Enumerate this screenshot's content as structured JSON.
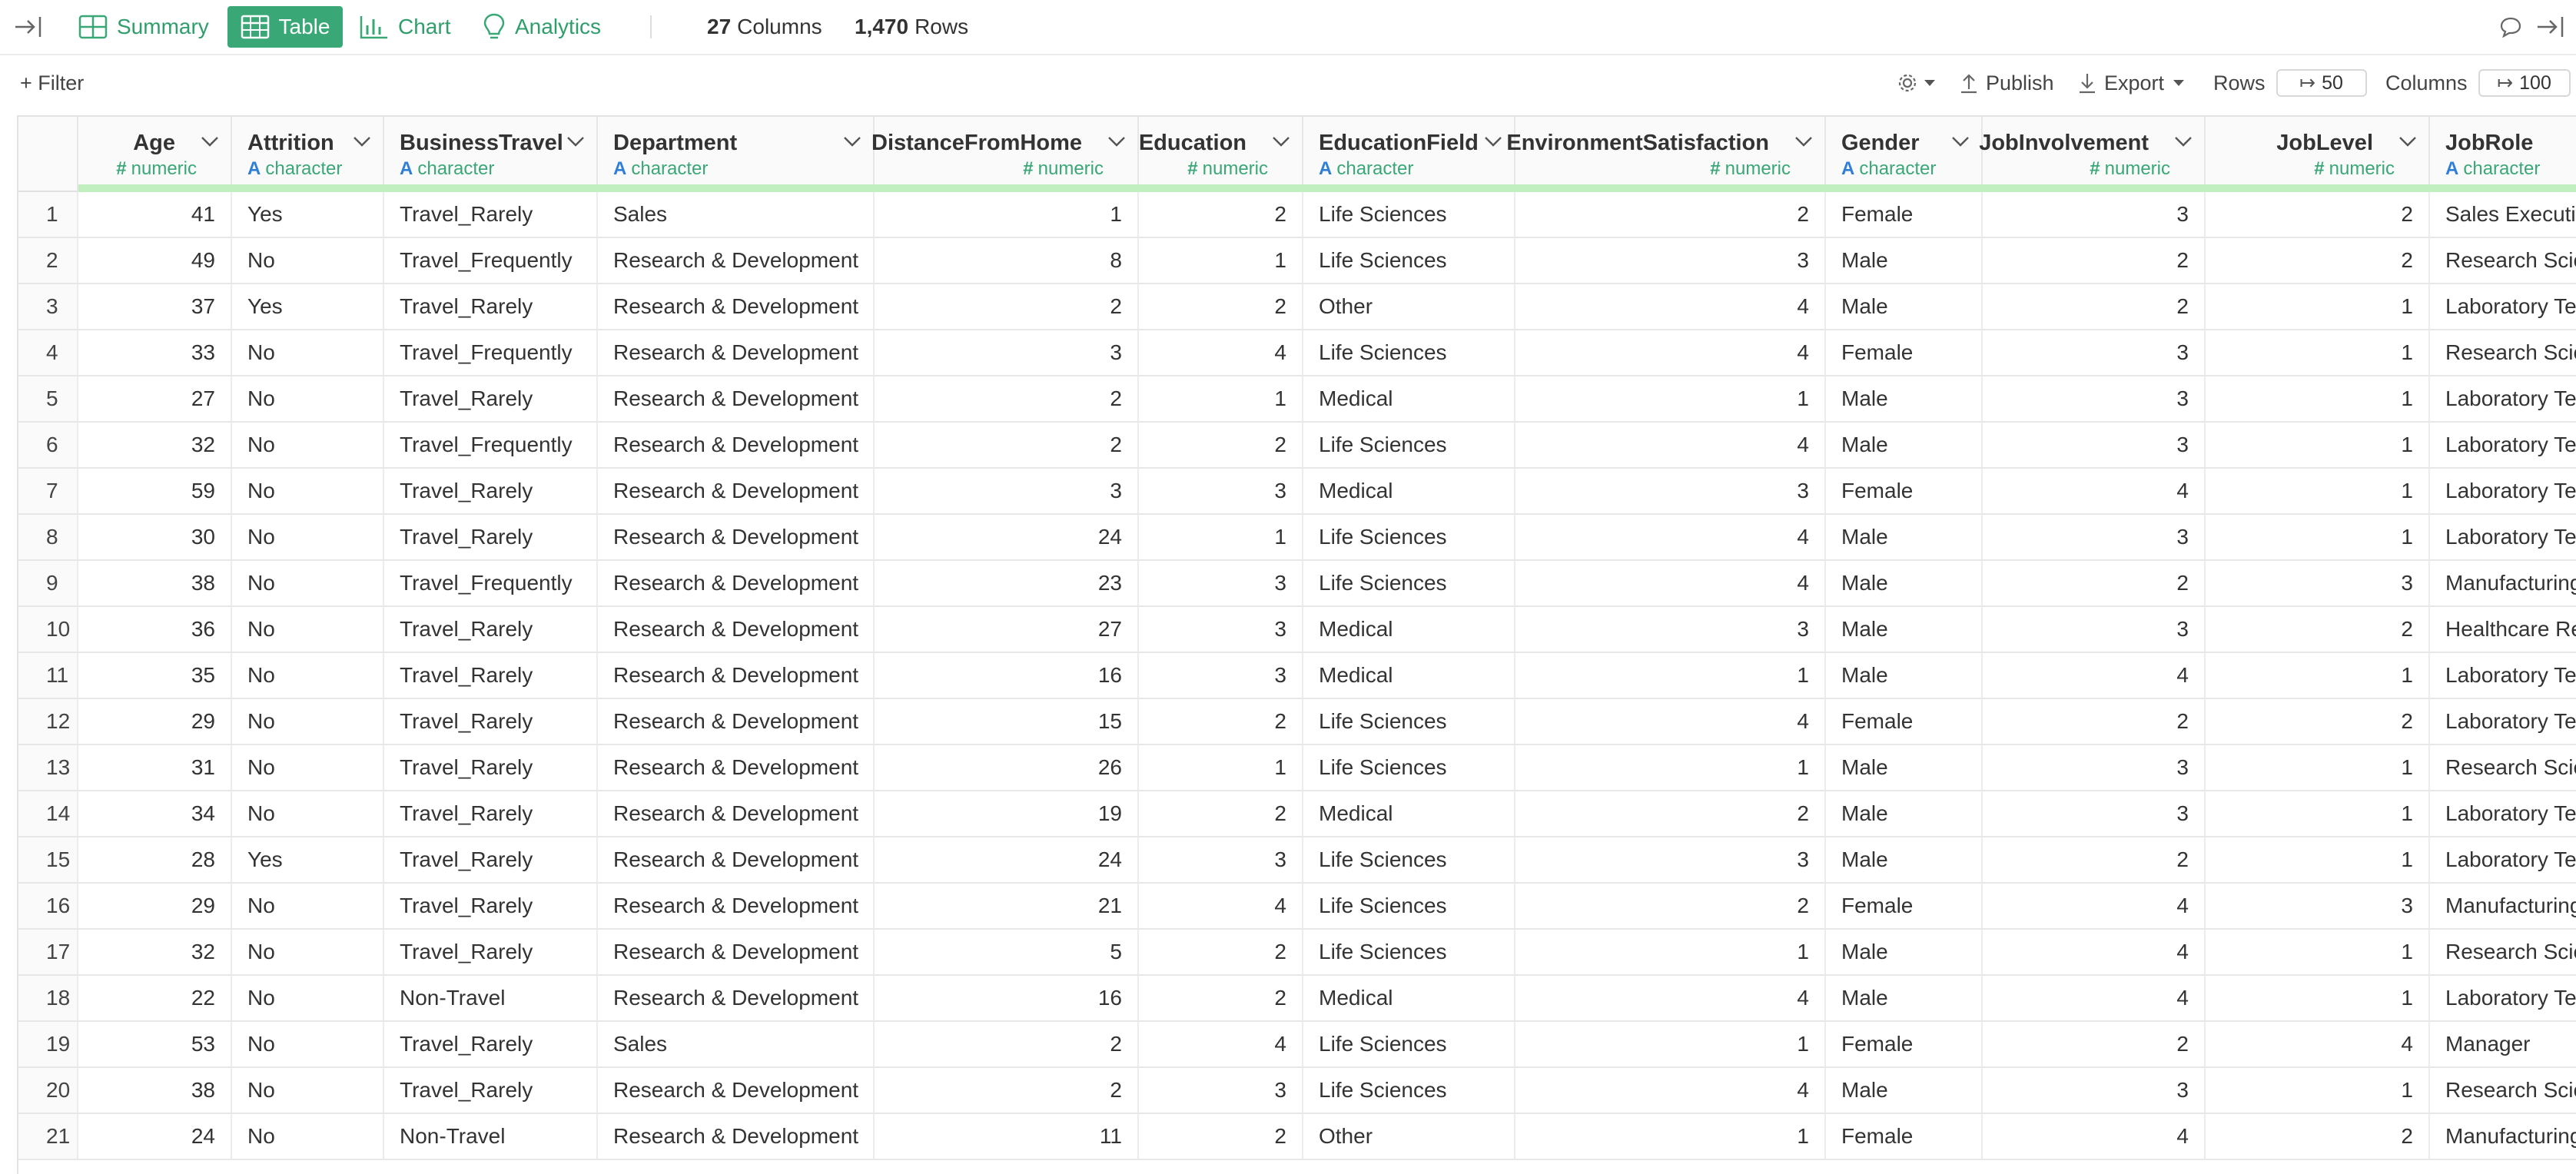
{
  "topbar": {
    "tabs": [
      {
        "label": "Summary",
        "icon": "summary-grid-icon",
        "active": false
      },
      {
        "label": "Table",
        "icon": "table-icon",
        "active": true
      },
      {
        "label": "Chart",
        "icon": "bar-chart-icon",
        "active": false
      },
      {
        "label": "Analytics",
        "icon": "lightbulb-icon",
        "active": false
      }
    ],
    "columns_count": "27",
    "columns_label": "Columns",
    "rows_count": "1,470",
    "rows_label": "Rows"
  },
  "toolbar": {
    "filter_label": "+ Filter",
    "publish_label": "Publish",
    "export_label": "Export",
    "rows_label": "Rows",
    "rows_value": "50",
    "columns_label": "Columns",
    "columns_value": "100"
  },
  "colors": {
    "accent": "#3aa777",
    "character_type": "#2f7ed8",
    "quality_bar": "#c2efc0"
  },
  "table": {
    "columns": [
      {
        "name": "Age",
        "type": "numeric"
      },
      {
        "name": "Attrition",
        "type": "character"
      },
      {
        "name": "BusinessTravel",
        "type": "character"
      },
      {
        "name": "Department",
        "type": "character"
      },
      {
        "name": "DistanceFromHome",
        "type": "numeric"
      },
      {
        "name": "Education",
        "type": "numeric"
      },
      {
        "name": "EducationField",
        "type": "character"
      },
      {
        "name": "EnvironmentSatisfaction",
        "type": "numeric"
      },
      {
        "name": "Gender",
        "type": "character"
      },
      {
        "name": "JobInvolvement",
        "type": "numeric"
      },
      {
        "name": "JobLevel",
        "type": "numeric"
      },
      {
        "name": "JobRole",
        "type": "character"
      }
    ],
    "rows": [
      [
        "1",
        "41",
        "Yes",
        "Travel_Rarely",
        "Sales",
        "1",
        "2",
        "Life Sciences",
        "2",
        "Female",
        "3",
        "2",
        "Sales Executive"
      ],
      [
        "2",
        "49",
        "No",
        "Travel_Frequently",
        "Research & Development",
        "8",
        "1",
        "Life Sciences",
        "3",
        "Male",
        "2",
        "2",
        "Research Scientist"
      ],
      [
        "3",
        "37",
        "Yes",
        "Travel_Rarely",
        "Research & Development",
        "2",
        "2",
        "Other",
        "4",
        "Male",
        "2",
        "1",
        "Laboratory Technician"
      ],
      [
        "4",
        "33",
        "No",
        "Travel_Frequently",
        "Research & Development",
        "3",
        "4",
        "Life Sciences",
        "4",
        "Female",
        "3",
        "1",
        "Research Scientist"
      ],
      [
        "5",
        "27",
        "No",
        "Travel_Rarely",
        "Research & Development",
        "2",
        "1",
        "Medical",
        "1",
        "Male",
        "3",
        "1",
        "Laboratory Technician"
      ],
      [
        "6",
        "32",
        "No",
        "Travel_Frequently",
        "Research & Development",
        "2",
        "2",
        "Life Sciences",
        "4",
        "Male",
        "3",
        "1",
        "Laboratory Technician"
      ],
      [
        "7",
        "59",
        "No",
        "Travel_Rarely",
        "Research & Development",
        "3",
        "3",
        "Medical",
        "3",
        "Female",
        "4",
        "1",
        "Laboratory Technician"
      ],
      [
        "8",
        "30",
        "No",
        "Travel_Rarely",
        "Research & Development",
        "24",
        "1",
        "Life Sciences",
        "4",
        "Male",
        "3",
        "1",
        "Laboratory Technician"
      ],
      [
        "9",
        "38",
        "No",
        "Travel_Frequently",
        "Research & Development",
        "23",
        "3",
        "Life Sciences",
        "4",
        "Male",
        "2",
        "3",
        "Manufacturing Director"
      ],
      [
        "10",
        "36",
        "No",
        "Travel_Rarely",
        "Research & Development",
        "27",
        "3",
        "Medical",
        "3",
        "Male",
        "3",
        "2",
        "Healthcare Representative"
      ],
      [
        "11",
        "35",
        "No",
        "Travel_Rarely",
        "Research & Development",
        "16",
        "3",
        "Medical",
        "1",
        "Male",
        "4",
        "1",
        "Laboratory Technician"
      ],
      [
        "12",
        "29",
        "No",
        "Travel_Rarely",
        "Research & Development",
        "15",
        "2",
        "Life Sciences",
        "4",
        "Female",
        "2",
        "2",
        "Laboratory Technician"
      ],
      [
        "13",
        "31",
        "No",
        "Travel_Rarely",
        "Research & Development",
        "26",
        "1",
        "Life Sciences",
        "1",
        "Male",
        "3",
        "1",
        "Research Scientist"
      ],
      [
        "14",
        "34",
        "No",
        "Travel_Rarely",
        "Research & Development",
        "19",
        "2",
        "Medical",
        "2",
        "Male",
        "3",
        "1",
        "Laboratory Technician"
      ],
      [
        "15",
        "28",
        "Yes",
        "Travel_Rarely",
        "Research & Development",
        "24",
        "3",
        "Life Sciences",
        "3",
        "Male",
        "2",
        "1",
        "Laboratory Technician"
      ],
      [
        "16",
        "29",
        "No",
        "Travel_Rarely",
        "Research & Development",
        "21",
        "4",
        "Life Sciences",
        "2",
        "Female",
        "4",
        "3",
        "Manufacturing Director"
      ],
      [
        "17",
        "32",
        "No",
        "Travel_Rarely",
        "Research & Development",
        "5",
        "2",
        "Life Sciences",
        "1",
        "Male",
        "4",
        "1",
        "Research Scientist"
      ],
      [
        "18",
        "22",
        "No",
        "Non-Travel",
        "Research & Development",
        "16",
        "2",
        "Medical",
        "4",
        "Male",
        "4",
        "1",
        "Laboratory Technician"
      ],
      [
        "19",
        "53",
        "No",
        "Travel_Rarely",
        "Sales",
        "2",
        "4",
        "Life Sciences",
        "1",
        "Female",
        "2",
        "4",
        "Manager"
      ],
      [
        "20",
        "38",
        "No",
        "Travel_Rarely",
        "Research & Development",
        "2",
        "3",
        "Life Sciences",
        "4",
        "Male",
        "3",
        "1",
        "Research Scientist"
      ],
      [
        "21",
        "24",
        "No",
        "Non-Travel",
        "Research & Development",
        "11",
        "2",
        "Other",
        "1",
        "Female",
        "4",
        "2",
        "Manufacturing Director"
      ]
    ]
  }
}
